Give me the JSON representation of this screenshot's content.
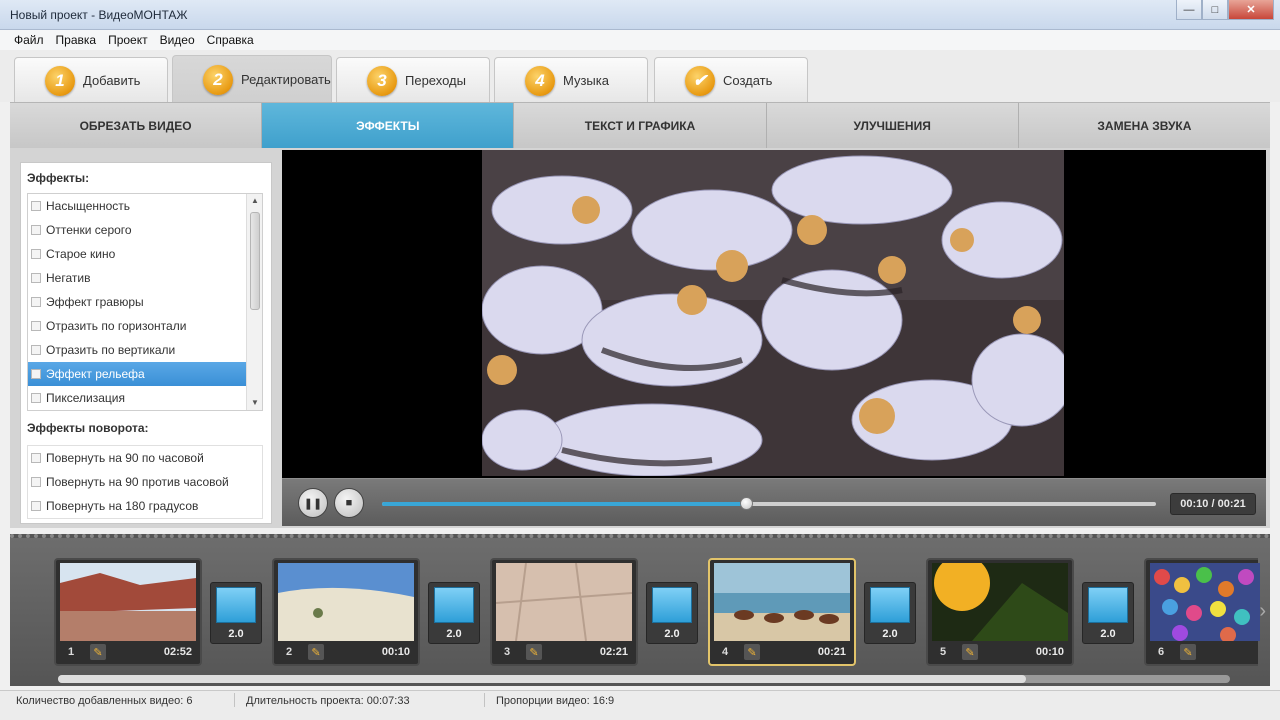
{
  "window": {
    "title": "Новый проект - ВидеоМОНТАЖ",
    "buttons": {
      "minimize": "—",
      "maximize": "□",
      "close": "✕"
    }
  },
  "menu": [
    "Файл",
    "Правка",
    "Проект",
    "Видео",
    "Справка"
  ],
  "steps": [
    {
      "num": "1",
      "label": "Добавить"
    },
    {
      "num": "2",
      "label": "Редактировать"
    },
    {
      "num": "3",
      "label": "Переходы"
    },
    {
      "num": "4",
      "label": "Музыка"
    },
    {
      "num": "✔",
      "label": "Создать"
    }
  ],
  "subtabs": [
    "ОБРЕЗАТЬ ВИДЕО",
    "ЭФФЕКТЫ",
    "ТЕКСТ И ГРАФИКА",
    "УЛУЧШЕНИЯ",
    "ЗАМЕНА ЗВУКА"
  ],
  "effects": {
    "heading": "Эффекты:",
    "items": [
      "Насыщенность",
      "Оттенки серого",
      "Старое кино",
      "Негатив",
      "Эффект гравюры",
      "Отразить по горизонтали",
      "Отразить по вертикали",
      "Эффект рельефа",
      "Пикселизация"
    ],
    "selected_index": 7
  },
  "rotation": {
    "heading": "Эффекты поворота:",
    "items": [
      "Повернуть на 90 по часовой",
      "Повернуть на 90 против часовой",
      "Повернуть на 180 градусов"
    ]
  },
  "player": {
    "time": "00:10 / 00:21",
    "progress": 0.47
  },
  "timeline": {
    "clips": [
      {
        "num": "1",
        "duration": "02:52",
        "scene": "canyon"
      },
      {
        "num": "2",
        "duration": "00:10",
        "scene": "desert"
      },
      {
        "num": "3",
        "duration": "02:21",
        "scene": "tiles"
      },
      {
        "num": "4",
        "duration": "00:21",
        "scene": "horses",
        "active": true
      },
      {
        "num": "5",
        "duration": "00:10",
        "scene": "sunset"
      },
      {
        "num": "6",
        "duration": "",
        "scene": "balls"
      }
    ],
    "transitions": [
      "2.0",
      "2.0",
      "2.0",
      "2.0",
      "2.0"
    ]
  },
  "status": {
    "count": "Количество добавленных видео: 6",
    "duration": "Длительность проекта:  00:07:33",
    "ratio": "Пропорции видео:  16:9"
  },
  "colors": {
    "accent": "#3fa0cc",
    "step_badge": "#e89a12",
    "active_clip_border": "#e2c46a"
  }
}
